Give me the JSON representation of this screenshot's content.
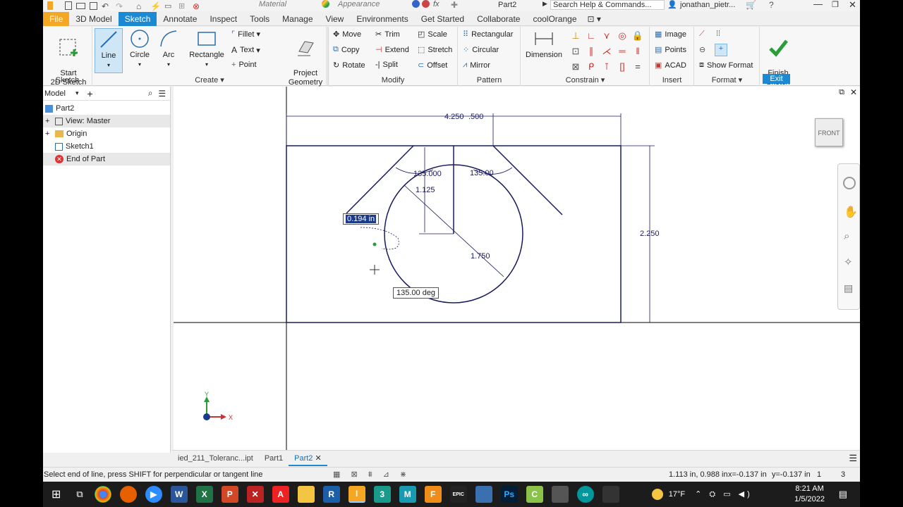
{
  "titlebar": {
    "material": "Material",
    "appearance": "Appearance",
    "fx": "fx",
    "doc_title": "Part2",
    "search_placeholder": "Search Help & Commands...",
    "user": "jonathan_pietr...",
    "help": "?"
  },
  "tabs": [
    "File",
    "3D Model",
    "Sketch",
    "Annotate",
    "Inspect",
    "Tools",
    "Manage",
    "View",
    "Environments",
    "Get Started",
    "Collaborate",
    "coolOrange"
  ],
  "active_tab": "Sketch",
  "ribbon": {
    "sketch_group": {
      "label": "Sketch",
      "start": "Start\n2D Sketch"
    },
    "create_group": {
      "label": "Create",
      "line": "Line",
      "circle": "Circle",
      "arc": "Arc",
      "rectangle": "Rectangle",
      "fillet": "Fillet",
      "text": "Text",
      "point": "Point"
    },
    "project_group": {
      "project": "Project\nGeometry"
    },
    "modify_group": {
      "label": "Modify",
      "move": "Move",
      "copy": "Copy",
      "rotate": "Rotate",
      "trim": "Trim",
      "extend": "Extend",
      "split": "Split",
      "scale": "Scale",
      "stretch": "Stretch",
      "offset": "Offset"
    },
    "pattern_group": {
      "label": "Pattern",
      "rectangular": "Rectangular",
      "circular": "Circular",
      "mirror": "Mirror"
    },
    "constrain_group": {
      "label": "Constrain",
      "dimension": "Dimension"
    },
    "insert_group": {
      "label": "Insert",
      "image": "Image",
      "points": "Points",
      "acad": "ACAD"
    },
    "format_group": {
      "label": "Format",
      "show_format": "Show Format"
    },
    "exit_group": {
      "label": "Exit",
      "finish": "Finish\nSketch"
    }
  },
  "browser": {
    "title": "Model",
    "items": [
      {
        "label": "Part2",
        "icon": "part-icon"
      },
      {
        "label": "View: Master",
        "icon": "view-icon"
      },
      {
        "label": "Origin",
        "icon": "folder-icon"
      },
      {
        "label": "Sketch1",
        "icon": "sketch-icon"
      },
      {
        "label": "End of Part",
        "icon": "end-of-part-icon"
      }
    ]
  },
  "sketch": {
    "dim_width": "4.250",
    "dim_offset": ".500",
    "dim_height": "2.250",
    "dim_angle_left": "135.000",
    "dim_angle_right": "135.00",
    "dim_vertical": "1.125",
    "dim_diameter": "1.750",
    "input_length": "0.194 in",
    "input_angle": "135.00 deg"
  },
  "viewcube": {
    "face": "FRONT"
  },
  "axes": {
    "x": "X",
    "y": "Y"
  },
  "doc_tabs": [
    {
      "label": "ied_211_Toleranc...ipt",
      "active": false
    },
    {
      "label": "Part1",
      "active": false
    },
    {
      "label": "Part2",
      "active": true
    }
  ],
  "status": {
    "prompt": "Select end of line, press SHIFT for perpendicular or tangent line",
    "coords": "1.113 in, 0.988 in",
    "x": "x=-0.137 in",
    "y": "y=-0.137 in",
    "n1": "1",
    "n2": "3"
  },
  "taskbar": {
    "weather": "17°F",
    "time": "8:21 AM",
    "date": "1/5/2022"
  },
  "colors": {
    "accent": "#1b8ad3",
    "file_tab": "#f5a623",
    "sketch_line": "#1a1a5e",
    "dim_color": "#1a1a5e",
    "finish_green": "#2a9d3a"
  }
}
